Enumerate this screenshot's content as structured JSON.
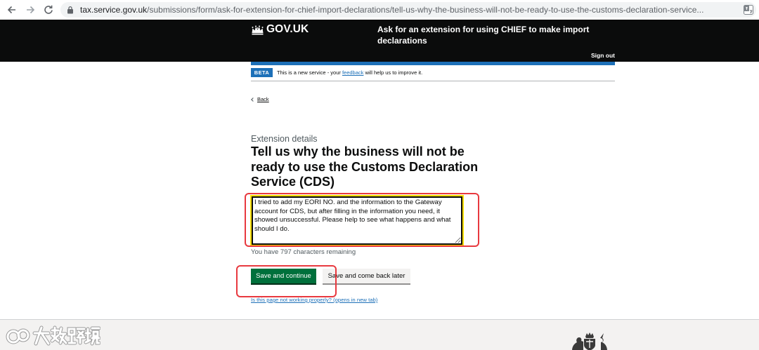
{
  "browser": {
    "url_domain": "tax.service.gov.uk",
    "url_path": "/submissions/form/ask-for-extension-for-chief-import-declarations/tell-us-why-the-business-will-not-be-ready-to-use-the-customs-declaration-service...",
    "icons": {
      "back": "arrow-left-icon",
      "forward": "arrow-right-icon",
      "reload": "reload-icon",
      "secure": "lock-icon",
      "translate": "translate-icon"
    }
  },
  "header": {
    "logo_text": "GOV.UK",
    "logo_icon": "crown-icon",
    "service_name": "Ask for an extension for using CHIEF to make import declarations",
    "sign_out": "Sign out"
  },
  "phase_banner": {
    "tag": "BETA",
    "text_before": "This is a new service - your ",
    "feedback_link": "feedback",
    "text_after": " will help us to improve it."
  },
  "back_link": {
    "label": "Back",
    "icon": "chevron-left-icon"
  },
  "form": {
    "caption": "Extension details",
    "heading": "Tell us why the business will not be ready to use the Customs Declaration Service (CDS)",
    "reason_value": "I tried to add my EORI NO. and the information to the Gateway account for CDS, but after filling in the information you need, it showed unsuccessful. Please help to see what happens and what should I do.",
    "character_count": "You have 797 characters remaining",
    "primary_button": "Save and continue",
    "secondary_button": "Save and come back later",
    "help_link": "Is this page not working properly? (opens in new tab)"
  },
  "footer": {
    "crest_icon": "royal-coat-of-arms-icon"
  },
  "watermark": {
    "text": "大数跨境"
  },
  "colors": {
    "header_background": "#0b0c0c",
    "brand_blue": "#1d70b8",
    "primary_button": "#00703c",
    "secondary_button": "#f3f2f1",
    "focus_yellow": "#ffdd00",
    "annotation_red": "#e8393f",
    "footer_background": "#f3f2f1"
  }
}
